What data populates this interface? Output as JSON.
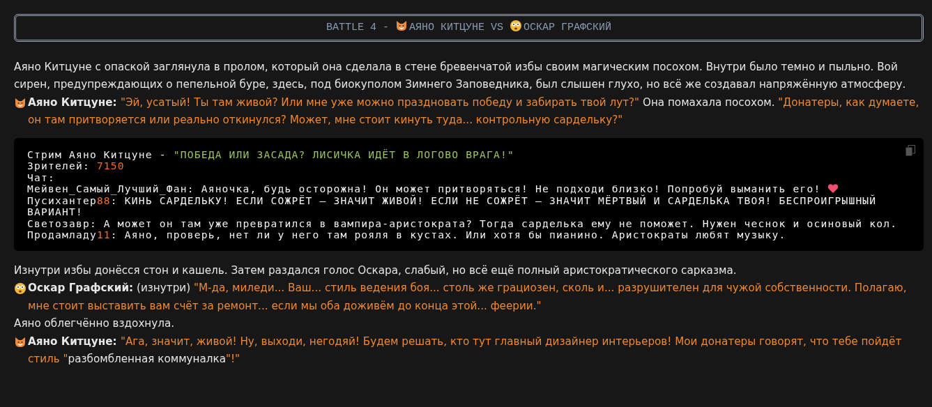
{
  "banner": [
    {
      "kind": "text",
      "text": "BATTLE 4 - "
    },
    {
      "kind": "fox"
    },
    {
      "kind": "text",
      "text": "АЯНО КИТЦУНЕ VS "
    },
    {
      "kind": "face"
    },
    {
      "kind": "text",
      "text": "ОСКАР ГРАФСКИЙ"
    }
  ],
  "blocks": [
    {
      "kind": "narration",
      "segments": [
        {
          "kind": "plain",
          "text": "Аяно Китцуне с опаской заглянула в пролом, который она сделала в стене бревенчатой избы своим магическим посохом. Внутри было темно и пыльно. Вой сирен, предупреждающих о пепельной буре, здесь, под биокуполом Зимнего Заповедника, был слышен глухо, но всё же создавал напряжённую атмосферу."
        }
      ]
    },
    {
      "kind": "fox_line",
      "segments": [
        {
          "kind": "speaker",
          "text": "Аяно Китцуне: "
        },
        {
          "kind": "speech",
          "text": "\"Эй, усатый! Ты там живой? Или мне уже можно праздновать победу и забирать твой лут?\""
        },
        {
          "kind": "plain",
          "text": " Она помахала посохом. "
        },
        {
          "kind": "speech",
          "text": "\"Донатеры, как думаете, он там притворяется или реально откинулся? Может, мне стоит кинуть туда... контрольную сардельку?\""
        }
      ]
    },
    {
      "kind": "code",
      "lines": [
        {
          "segments": [
            {
              "kind": "plain",
              "text": "Стрим Аяно Китцуне - "
            },
            {
              "kind": "quote",
              "text": "\"ПОБЕДА ИЛИ ЗАСАДА? ЛИСИЧКА ИДЁТ В ЛОГОВО ВРАГА!\""
            }
          ]
        },
        {
          "segments": [
            {
              "kind": "plain",
              "text": "Зрителей: "
            },
            {
              "kind": "number",
              "text": "7150"
            }
          ]
        },
        {
          "segments": [
            {
              "kind": "plain",
              "text": "Чат:"
            }
          ]
        },
        {
          "segments": [
            {
              "kind": "plain",
              "text": "Мейвен_Самый_Лучший_Фан: Аяночка, будь осторожна! Он может притворяться! Не подходи близко! Попробуй выманить его! "
            },
            {
              "kind": "heart"
            }
          ]
        },
        {
          "segments": [
            {
              "kind": "plain",
              "text": "Пусихантер"
            },
            {
              "kind": "number",
              "text": "88"
            },
            {
              "kind": "plain",
              "text": ": КИНЬ САРДЕЛЬКУ! ЕСЛИ СОЖРЁТ – ЗНАЧИТ ЖИВОЙ! ЕСЛИ НЕ СОЖРЁТ – ЗНАЧИТ МЁРТВЫЙ И САРДЕЛЬКА ТВОЯ! БЕСПРОИГРЫШНЫЙ ВАРИАНТ!"
            }
          ]
        },
        {
          "segments": [
            {
              "kind": "plain",
              "text": "Светозавр: А может он там уже превратился в вампира-аристократа? Тогда сарделька ему не поможет. Нужен чеснок и осиновый кол."
            }
          ]
        },
        {
          "segments": [
            {
              "kind": "plain",
              "text": "Продамладу"
            },
            {
              "kind": "number",
              "text": "11"
            },
            {
              "kind": "plain",
              "text": ": Аяно, проверь, нет ли у него там рояля в кустах. Или хотя бы пианино. Аристократы любят музыку."
            }
          ]
        }
      ]
    },
    {
      "kind": "narration",
      "segments": [
        {
          "kind": "plain",
          "text": "Изнутри избы донёсся стон и кашель. Затем раздался голос Оскара, слабый, но всё ещё полный аристократического сарказма."
        }
      ]
    },
    {
      "kind": "face_line",
      "segments": [
        {
          "kind": "speaker",
          "text": "Оскар Графский:"
        },
        {
          "kind": "plain",
          "text": " (изнутри) "
        },
        {
          "kind": "speech",
          "text": "\"М-да, миледи... Ваш... стиль ведения боя... столь же грациозен, сколь и... разрушителен для чужой собственности. Полагаю, мне стоит выставить вам счёт за ремонт... если мы оба доживём до конца этой... феерии.\""
        }
      ]
    },
    {
      "kind": "narration",
      "segments": [
        {
          "kind": "plain",
          "text": "Аяно облегчённо вздохнула."
        }
      ]
    },
    {
      "kind": "fox_line",
      "segments": [
        {
          "kind": "speaker",
          "text": "Аяно Китцуне: "
        },
        {
          "kind": "speech",
          "text": "\"Ага, значит, живой! Ну, выходи, негодяй! Будем решать, кто тут главный дизайнер интерьеров! Мои донатеры говорят, что тебе пойдёт стиль \""
        },
        {
          "kind": "plain",
          "text": "разбомбленная коммуналка"
        },
        {
          "kind": "speech",
          "text": "\"!\""
        }
      ]
    }
  ]
}
